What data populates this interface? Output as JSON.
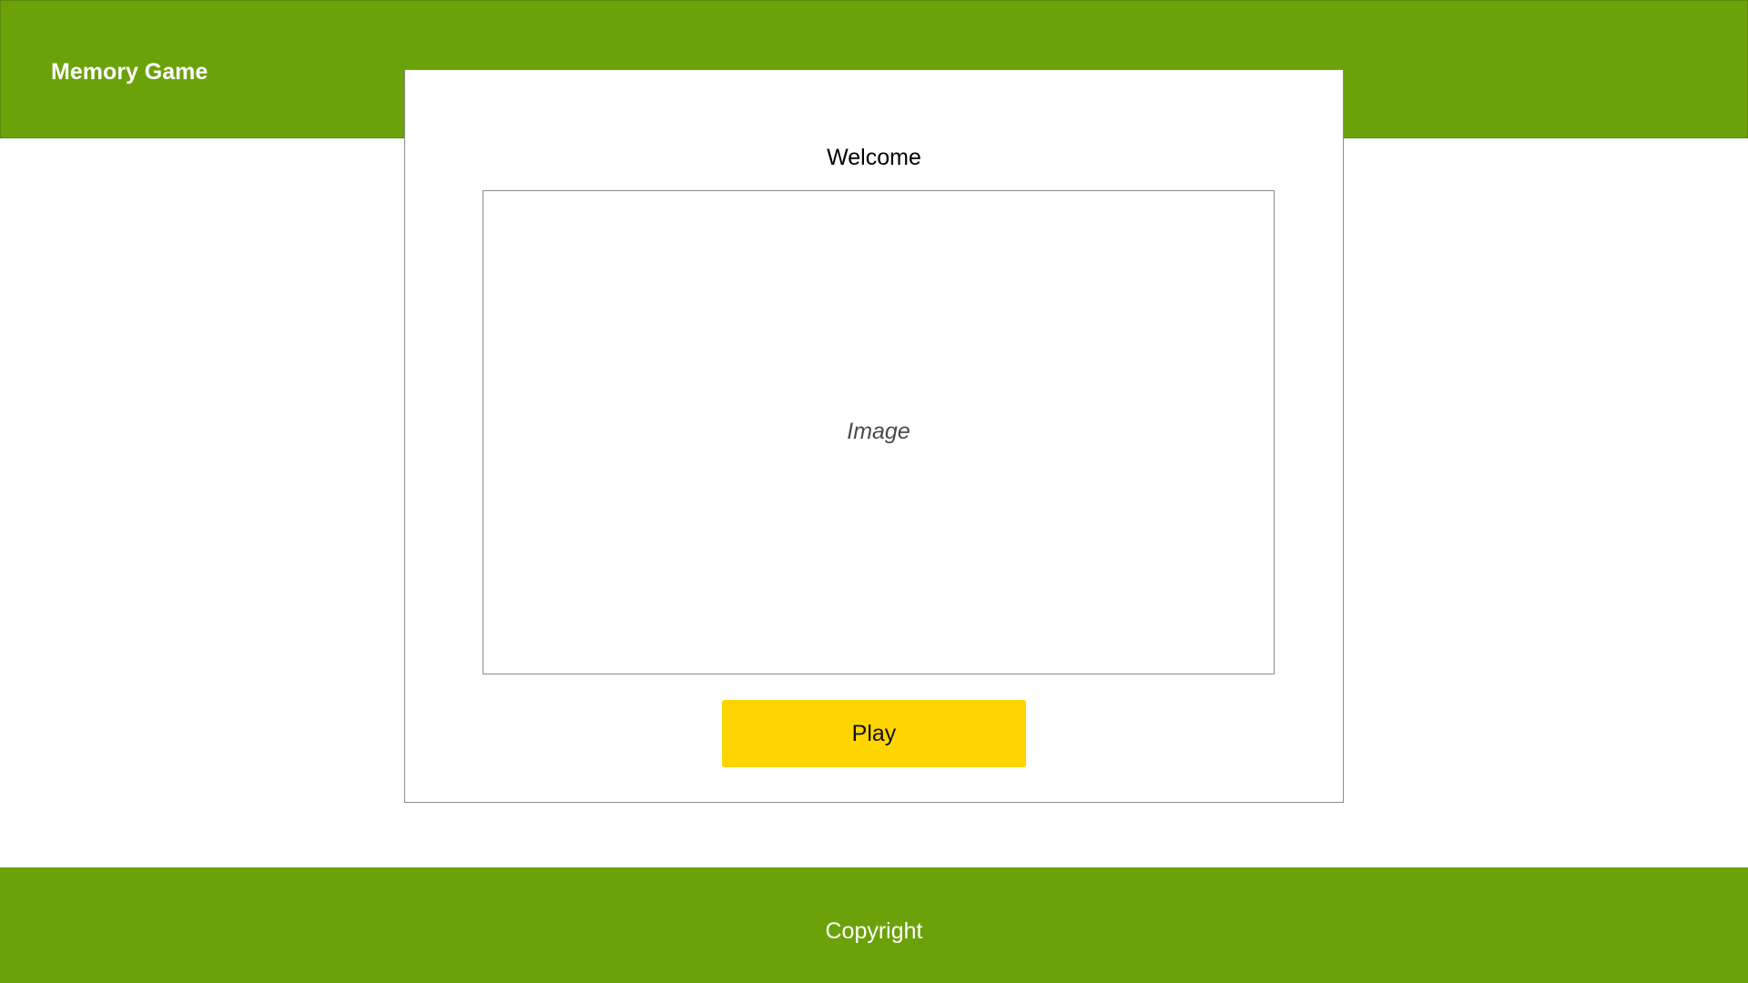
{
  "colors": {
    "header_background": "#6ba20a",
    "footer_background": "#6ba20a",
    "header_text": "#ffffff",
    "footer_text": "#ffffff",
    "play_button_background": "#ffd500",
    "card_border": "#8c8c8c"
  },
  "header": {
    "title": "Memory Game"
  },
  "welcome_card": {
    "heading": "Welcome",
    "image_placeholder": "Image",
    "play_label": "Play"
  },
  "footer": {
    "text": "Copyright"
  }
}
